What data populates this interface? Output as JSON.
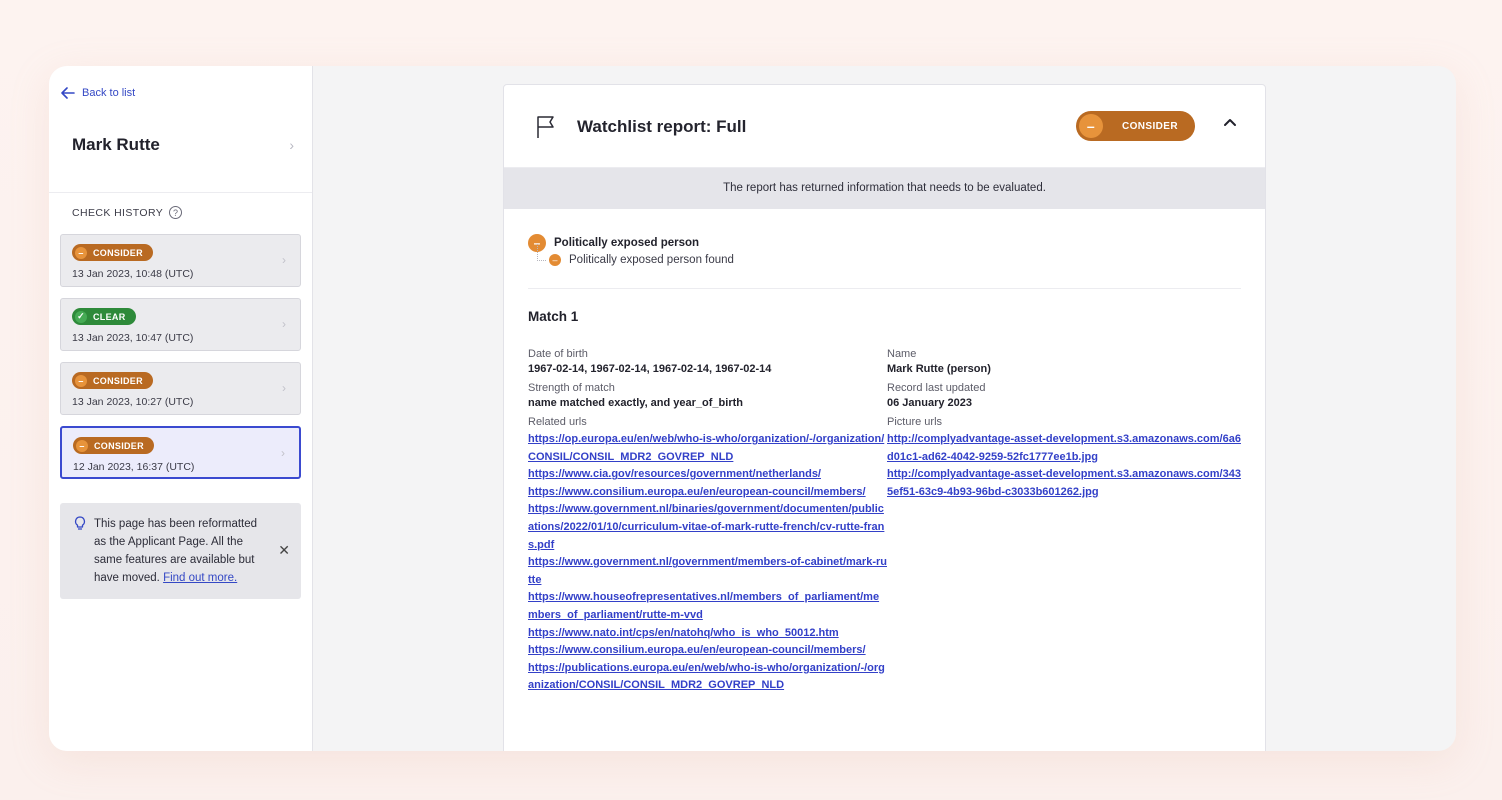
{
  "sidebar": {
    "back_label": "Back to list",
    "applicant_name": "Mark Rutte",
    "history_title": "CHECK HISTORY",
    "history": [
      {
        "status": "CONSIDER",
        "time": "13 Jan 2023, 10:48 (UTC)"
      },
      {
        "status": "CLEAR",
        "time": "13 Jan 2023, 10:47 (UTC)"
      },
      {
        "status": "CONSIDER",
        "time": "13 Jan 2023, 10:27 (UTC)"
      },
      {
        "status": "CONSIDER",
        "time": "12 Jan 2023, 16:37 (UTC)"
      }
    ],
    "notice_text": "This page has been reformatted as the Applicant Page. All the same features are available but have moved.",
    "notice_link": "Find out more."
  },
  "report": {
    "title": "Watchlist report: Full",
    "status": "CONSIDER",
    "banner": "The report has returned information that needs to be evaluated.",
    "breakdown_main": "Politically exposed person",
    "breakdown_sub": "Politically exposed person found",
    "match": {
      "title": "Match 1",
      "dob_label": "Date of birth",
      "dob_value": "1967-02-14, 1967-02-14, 1967-02-14, 1967-02-14",
      "name_label": "Name",
      "name_value": "Mark Rutte (person)",
      "strength_label": "Strength of match",
      "strength_value": "name matched exactly, and year_of_birth",
      "updated_label": "Record last updated",
      "updated_value": "06 January 2023",
      "related_label": "Related urls",
      "related_urls": [
        "https://op.europa.eu/en/web/who-is-who/organization/-/organization/CONSIL/CONSIL_MDR2_GOVREP_NLD",
        "https://www.cia.gov/resources/government/netherlands/",
        "https://www.consilium.europa.eu/en/european-council/members/",
        "https://www.government.nl/binaries/government/documenten/publications/2022/01/10/curriculum-vitae-of-mark-rutte-french/cv-rutte-frans.pdf",
        "https://www.government.nl/government/members-of-cabinet/mark-rutte",
        "https://www.houseofrepresentatives.nl/members_of_parliament/members_of_parliament/rutte-m-vvd",
        "https://www.nato.int/cps/en/natohq/who_is_who_50012.htm",
        "https://www.consilium.europa.eu/en/european-council/members/",
        "https://publications.europa.eu/en/web/who-is-who/organization/-/organization/CONSIL/CONSIL_MDR2_GOVREP_NLD"
      ],
      "picture_label": "Picture urls",
      "picture_urls": [
        "http://complyadvantage-asset-development.s3.amazonaws.com/6a6d01c1-ad62-4042-9259-52fc1777ee1b.jpg",
        "http://complyadvantage-asset-development.s3.amazonaws.com/3435ef51-63c9-4b93-96bd-c3033b601262.jpg"
      ]
    }
  },
  "colors": {
    "accent": "#3448c5",
    "consider": "#b96a22",
    "consider_dot": "#e7933b",
    "clear": "#2e8a3a"
  }
}
